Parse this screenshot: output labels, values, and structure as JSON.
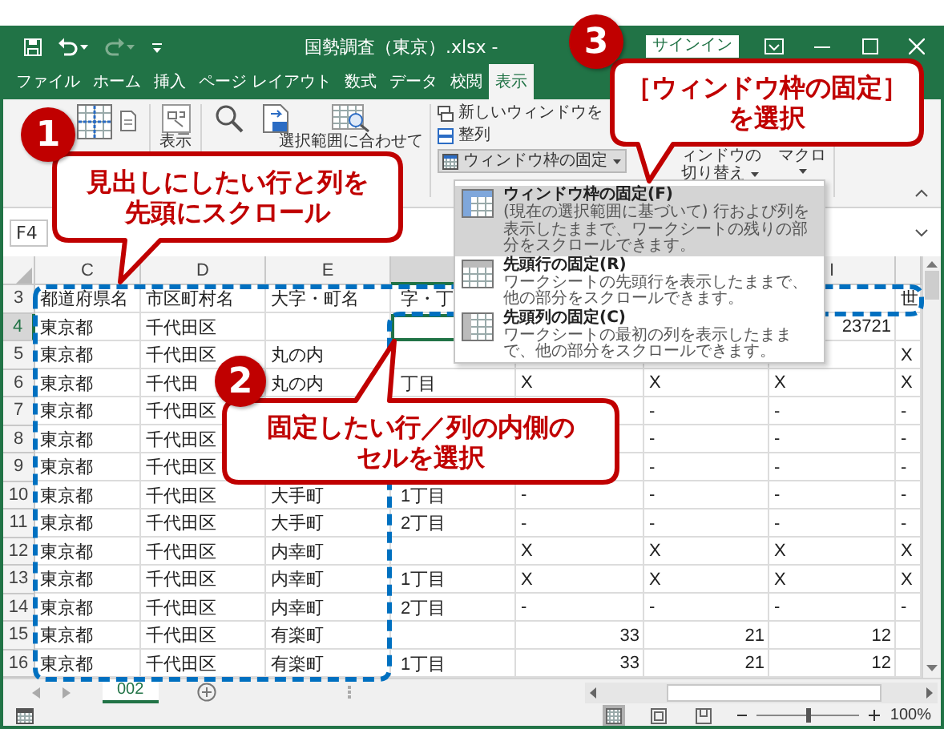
{
  "quick_access": [
    {
      "kind": "save",
      "disabled": false
    },
    {
      "kind": "undo",
      "disabled": false
    },
    {
      "kind": "redo",
      "disabled": true
    },
    {
      "kind": "customize",
      "disabled": false
    }
  ],
  "window": {
    "title": "国勢調査（東京）.xlsx -",
    "sign_in": "サインイン"
  },
  "tabs": [
    {
      "label": "ファイル",
      "selected": false
    },
    {
      "label": "ホーム",
      "selected": false
    },
    {
      "label": "挿入",
      "selected": false
    },
    {
      "label": "ページ レイアウト",
      "selected": false
    },
    {
      "label": "数式",
      "selected": false
    },
    {
      "label": "データ",
      "selected": false
    },
    {
      "label": "校閲",
      "selected": false
    },
    {
      "label": "表示",
      "selected": true
    }
  ],
  "ribbon": {
    "show": "表示",
    "zoom_to_selection": "選択範囲に合わせて",
    "new_window": "新しいウィンドウを",
    "arrange": "整列",
    "freeze_panes": {
      "label": "ウィンドウ枠の固定",
      "open": true
    },
    "switch_windows": {
      "line_1": "ィンドウの",
      "line_2": "切り替え"
    },
    "macros": "マクロ"
  },
  "name_box": "F4",
  "columns": [
    {
      "label": "C",
      "selected": false
    },
    {
      "label": "D",
      "selected": false
    },
    {
      "label": "E",
      "selected": false
    },
    {
      "selected": true
    },
    null,
    null,
    {
      "label": "I",
      "selected": false
    },
    {
      "selected": false
    }
  ],
  "rows": [
    {
      "header": "3",
      "selected": false,
      "cells": [
        "都道府県名",
        "市区町村名",
        "大字・町名",
        "字・丁",
        null,
        null,
        null,
        "世"
      ]
    },
    {
      "header": "4",
      "selected": true,
      "cells": [
        "東京都",
        "千代田区",
        null,
        null,
        null,
        null,
        {
          "value": "23721",
          "kind": "number"
        }
      ]
    },
    {
      "header": "5",
      "selected": false,
      "cells": [
        "東京都",
        "千代田区",
        "丸の内",
        null,
        null,
        null,
        null,
        "X"
      ]
    },
    {
      "header": "6",
      "selected": false,
      "cells": [
        "東京都",
        "千代田",
        "丸の内",
        "丁目",
        "X",
        "X",
        "X",
        "X"
      ]
    },
    {
      "header": "7",
      "selected": false,
      "cells": [
        "東京都",
        "千代田区",
        null,
        null,
        null,
        "-",
        "-",
        "-"
      ]
    },
    {
      "header": "8",
      "selected": false,
      "cells": [
        "東京都",
        "千代田区",
        null,
        null,
        null,
        "-",
        "-",
        "-"
      ]
    },
    {
      "header": "9",
      "selected": false,
      "cells": [
        "東京都",
        "千代田区",
        null,
        null,
        null,
        "-",
        "-",
        "-"
      ]
    },
    {
      "header": "10",
      "selected": false,
      "cells": [
        "東京都",
        "千代田区",
        "大手町",
        "1丁目",
        "-",
        "-",
        "-",
        "-"
      ]
    },
    {
      "header": "11",
      "selected": false,
      "cells": [
        "東京都",
        "千代田区",
        "大手町",
        "2丁目",
        "-",
        "-",
        "-",
        "-"
      ]
    },
    {
      "header": "12",
      "selected": false,
      "cells": [
        "東京都",
        "千代田区",
        "内幸町",
        null,
        "X",
        "X",
        "X",
        "X"
      ]
    },
    {
      "header": "13",
      "selected": false,
      "cells": [
        "東京都",
        "千代田区",
        "内幸町",
        "1丁目",
        "X",
        "X",
        "X",
        "X"
      ]
    },
    {
      "header": "14",
      "selected": false,
      "cells": [
        "東京都",
        "千代田区",
        "内幸町",
        "2丁目",
        "-",
        "-",
        "-",
        "-"
      ]
    },
    {
      "header": "15",
      "selected": false,
      "cells": [
        "東京都",
        "千代田区",
        "有楽町",
        null,
        {
          "value": "33",
          "kind": "number"
        },
        {
          "value": "21",
          "kind": "number"
        },
        {
          "value": "12",
          "kind": "number"
        }
      ]
    },
    {
      "header": "16",
      "selected": false,
      "cells": [
        "東京都",
        "千代田区",
        "有楽町",
        "1丁目",
        {
          "value": "33",
          "kind": "number"
        },
        {
          "value": "21",
          "kind": "number"
        },
        {
          "value": "12",
          "kind": "number"
        }
      ]
    }
  ],
  "sheet_tabs": [
    {
      "label": "002",
      "selected": true
    }
  ],
  "status_bar": {
    "views": [
      {
        "kind": "normal",
        "selected": true
      },
      {
        "kind": "page_layout",
        "selected": false
      },
      {
        "kind": "page_break",
        "selected": false
      }
    ],
    "zoom_slider": {
      "level": 0.5
    },
    "zoom": "100%"
  },
  "menu": {
    "items": [
      {
        "kind": "panes",
        "title": "ウィンドウ枠の固定(F)",
        "description": "(現在の選択範囲に基づいて) 行および列を表示したままで、ワークシートの残りの部分をスクロールできます。",
        "selected": true
      },
      {
        "kind": "top_row",
        "title": "先頭行の固定(R)",
        "description": "ワークシートの先頭行を表示したままで、他の部分をスクロールできます。",
        "selected": false
      },
      {
        "kind": "first_column",
        "title": "先頭列の固定(C)",
        "description": "ワークシートの最初の列を表示したままで、他の部分をスクロールできます。",
        "selected": false
      }
    ]
  },
  "callouts": [
    {
      "number": "1",
      "lines": [
        "見出しにしたい行と列を",
        "先頭にスクロール"
      ]
    },
    {
      "number": "2",
      "lines": [
        "固定したい行／列の内側の",
        "セルを選択"
      ]
    },
    {
      "number": "3",
      "lines": [
        "［ウィンドウ枠の固定］",
        "を選択"
      ]
    }
  ]
}
